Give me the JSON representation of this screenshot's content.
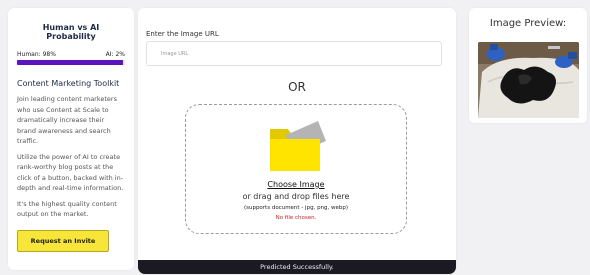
{
  "sidebar": {
    "probability_title": "Human vs AI Probability",
    "human_label": "Human: 98%",
    "ai_label": "AI: 2%",
    "human_fraction": 0.98,
    "heading": "Content Marketing Toolkit",
    "paragraphs": [
      "Join leading content marketers who use Content at Scale to dramatically increase their brand awareness and search traffic.",
      "Utilize the power of AI to create rank-worthy blog posts at the click of a button, backed with in-depth and real-time information.",
      "It's the highest quality content output on the market."
    ],
    "invite_button": "Request an Invite"
  },
  "main": {
    "url_label": "Enter the Image URL",
    "url_placeholder": "Image URL",
    "or_text": "OR",
    "choose_image": "Choose Image",
    "drag_text": "or drag and drop files here",
    "supports_text": "(supports document - jpg, png, webp)",
    "no_file_text": "No file chosen.",
    "status_text": "Predicted Successfully."
  },
  "preview": {
    "title": "Image Preview:"
  },
  "colors": {
    "accent_purple": "#5c14bf",
    "invite_yellow": "#f7e53a",
    "folder_yellow": "#ffe400",
    "error_red": "#c8202a",
    "status_bar": "#1b1a22"
  }
}
